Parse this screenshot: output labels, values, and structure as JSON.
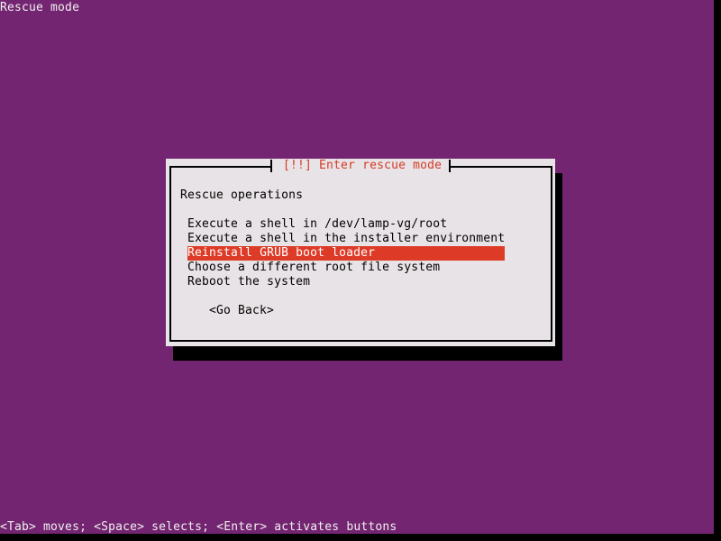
{
  "screen": {
    "title": "Rescue mode",
    "background_color": "#742571"
  },
  "dialog": {
    "title": "[!!] Enter rescue mode",
    "title_color": "#d43b27",
    "label": "Rescue operations",
    "menu": [
      {
        "label": "Execute a shell in /dev/lamp-vg/root",
        "selected": false
      },
      {
        "label": "Execute a shell in the installer environment",
        "selected": false
      },
      {
        "label": "Reinstall GRUB boot loader",
        "selected": true
      },
      {
        "label": "Choose a different root file system",
        "selected": false
      },
      {
        "label": "Reboot the system",
        "selected": false
      }
    ],
    "selection_color": "#dd3b28",
    "go_back_label": "<Go Back>"
  },
  "status_bar": {
    "text": "<Tab> moves; <Space> selects; <Enter> activates buttons"
  }
}
